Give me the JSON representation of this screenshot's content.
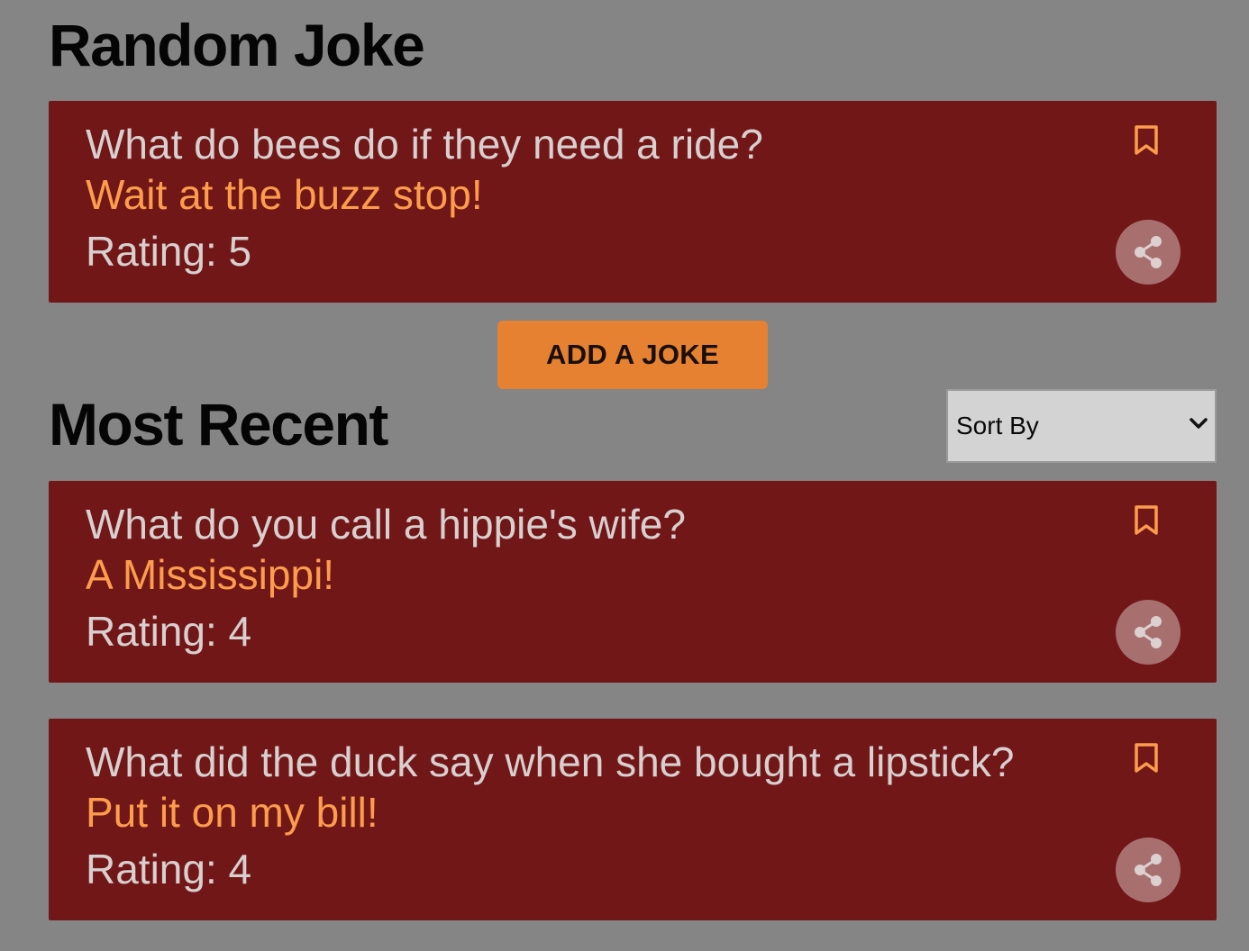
{
  "random_section": {
    "title": "Random Joke",
    "joke": {
      "question": "What do bees do if they need a ride?",
      "answer": "Wait at the buzz stop!",
      "rating": "Rating: 5"
    }
  },
  "add_joke_label": "ADD A JOKE",
  "recent_section": {
    "title": "Most Recent",
    "sort": {
      "selected": "Sort By"
    },
    "jokes": [
      {
        "question": "What do you call a hippie's wife?",
        "answer": "A Mississippi!",
        "rating": "Rating: 4"
      },
      {
        "question": "What did the duck say when she bought a lipstick?",
        "answer": "Put it on my bill!",
        "rating": "Rating: 4"
      }
    ]
  },
  "icons": {
    "bookmark": "bookmark-icon",
    "share": "share-icon",
    "dropdown": "chevron-down-icon"
  },
  "colors": {
    "page_background": "#858585",
    "card_background": "#721717",
    "question_text": "#d8cfcf",
    "answer_text": "#fb9d4d",
    "accent_button": "#e68132",
    "share_button": "#a86f6f"
  }
}
